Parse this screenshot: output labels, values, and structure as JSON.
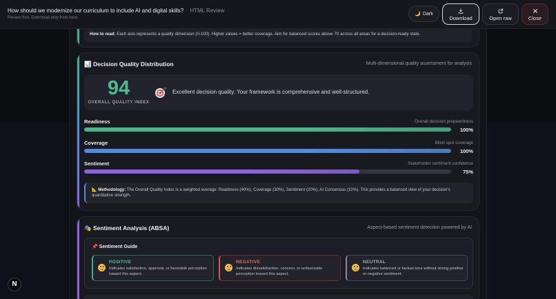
{
  "header": {
    "title": "How should we modernize our curriculum to include AI and digital skills?",
    "title_suffix": "· HTML Review",
    "subtitle": "Review first. Download only from here.",
    "dark_label": "Dark",
    "download_label": "Download",
    "open_raw_label": "Open raw",
    "close_label": "Close"
  },
  "how_to_read": {
    "label": "How to read:",
    "text": "Each axis represents a quality dimension (0-100). Higher values = better coverage. Aim for balanced scores above 70 across all areas for a decision-ready state."
  },
  "quality": {
    "title_icon": "📊",
    "title": "Decision Quality Distribution",
    "subtitle": "Multi-dimensional quality assessment for analysis",
    "score": "94",
    "score_label": "OVERALL QUALITY INDEX",
    "score_icon": "target-icon",
    "message": "Excellent decision quality. Your framework is comprehensive and well-structured.",
    "metrics": [
      {
        "name": "Readiness",
        "desc": "Overall decision preparedness",
        "value": "100%",
        "fill": 1.0,
        "color": "#45b88a"
      },
      {
        "name": "Coverage",
        "desc": "Blind spot coverage",
        "value": "100%",
        "fill": 1.0,
        "color": "#4f8ce0"
      },
      {
        "name": "Sentiment",
        "desc": "Stakeholder sentiment confidence",
        "value": "75%",
        "fill": 0.75,
        "color": "#8a63e0"
      }
    ],
    "methodology_label": "📐 Methodology:",
    "methodology_text": "The Overall Quality Index is a weighted average: Readiness (40%), Coverage (30%), Sentiment (20%), AI Consensus (10%). This provides a balanced view of your decision's quantitative strength."
  },
  "sentiment": {
    "title_icon": "🎭",
    "title": "Sentiment Analysis (ABSA)",
    "subtitle": "Aspect-based sentiment detection powered by AI",
    "guide_title": "📌 Sentiment Guide",
    "positive": {
      "label": "POSITIVE",
      "desc": "Indicates satisfaction, approval, or favorable perception toward this aspect."
    },
    "negative": {
      "label": "NEGATIVE",
      "desc": "Indicates dissatisfaction, concern, or unfavorable perception toward this aspect."
    },
    "neutral": {
      "label": "NEUTRAL",
      "desc": "Indicates balanced or factual tone without strong positive or negative sentiment."
    }
  },
  "badge": {
    "letter": "N"
  }
}
